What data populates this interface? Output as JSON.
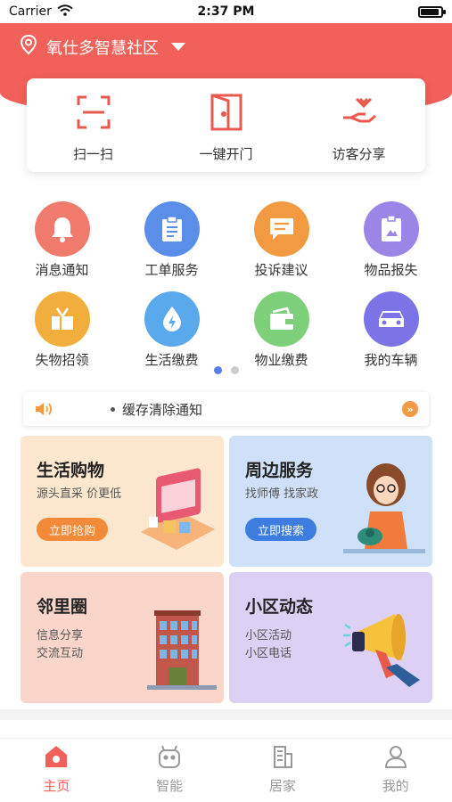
{
  "status_bar": {
    "carrier": "Carrier",
    "time": "2:37 PM"
  },
  "header": {
    "location": "氧仕多智慧社区"
  },
  "quick_actions": [
    {
      "label": "扫一扫",
      "icon": "scan-icon"
    },
    {
      "label": "一键开门",
      "icon": "door-icon"
    },
    {
      "label": "访客分享",
      "icon": "visitor-share-icon"
    }
  ],
  "grid": [
    {
      "label": "消息通知",
      "icon": "bell-icon",
      "color": "#f07a6c"
    },
    {
      "label": "工单服务",
      "icon": "clipboard-icon",
      "color": "#5b8ee8"
    },
    {
      "label": "投诉建议",
      "icon": "message-icon",
      "color": "#f29a42"
    },
    {
      "label": "物品报失",
      "icon": "badge-icon",
      "color": "#9b86e8"
    },
    {
      "label": "失物招领",
      "icon": "box-icon",
      "color": "#f2ae3c"
    },
    {
      "label": "生活缴费",
      "icon": "drop-icon",
      "color": "#5aa9ec"
    },
    {
      "label": "物业缴费",
      "icon": "wallet-icon",
      "color": "#7ecf7a"
    },
    {
      "label": "我的车辆",
      "icon": "car-icon",
      "color": "#7c74e6"
    }
  ],
  "pager": {
    "active": 0,
    "count": 2
  },
  "notice": {
    "text": "缓存清除通知",
    "more": "»"
  },
  "cards": [
    {
      "title": "生活购物",
      "lines": [
        "源头直采 价更低"
      ],
      "button": "立即抢购",
      "button_color": "#f28a3a"
    },
    {
      "title": "周边服务",
      "lines": [
        "找师傅 找家政"
      ],
      "button": "立即搜索",
      "button_color": "#3e7de0"
    },
    {
      "title": "邻里圈",
      "lines": [
        "信息分享",
        "交流互动"
      ],
      "button": ""
    },
    {
      "title": "小区动态",
      "lines": [
        "小区活动",
        "小区电话"
      ],
      "button": ""
    }
  ],
  "tabs": [
    {
      "label": "主页",
      "icon": "home-icon",
      "active": true
    },
    {
      "label": "智能",
      "icon": "robot-icon",
      "active": false
    },
    {
      "label": "居家",
      "icon": "building-icon",
      "active": false
    },
    {
      "label": "我的",
      "icon": "user-icon",
      "active": false
    }
  ]
}
